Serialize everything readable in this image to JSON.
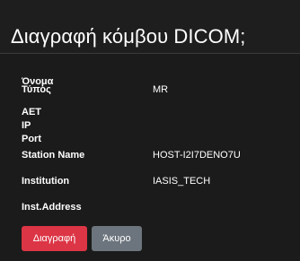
{
  "dialog": {
    "title": "Διαγραφή κόμβου DICOM;"
  },
  "fields": {
    "name": {
      "label": "Όνομα",
      "value": ""
    },
    "type": {
      "label": "Τύπος",
      "value": "MR"
    },
    "aet": {
      "label": "AET",
      "value": ""
    },
    "ip": {
      "label": "IP",
      "value": ""
    },
    "port": {
      "label": "Port",
      "value": ""
    },
    "station": {
      "label": "Station Name",
      "value": "HOST-I2I7DENO7U"
    },
    "institution": {
      "label": "Institution",
      "value": "IASIS_TECH"
    },
    "inst_address": {
      "label": "Inst.Address",
      "value": ""
    }
  },
  "buttons": {
    "delete_label": "Διαγραφή",
    "cancel_label": "Άκυρο"
  },
  "colors": {
    "background": "#1b1b1b",
    "danger": "#dc3545",
    "secondary": "#6c757d"
  }
}
